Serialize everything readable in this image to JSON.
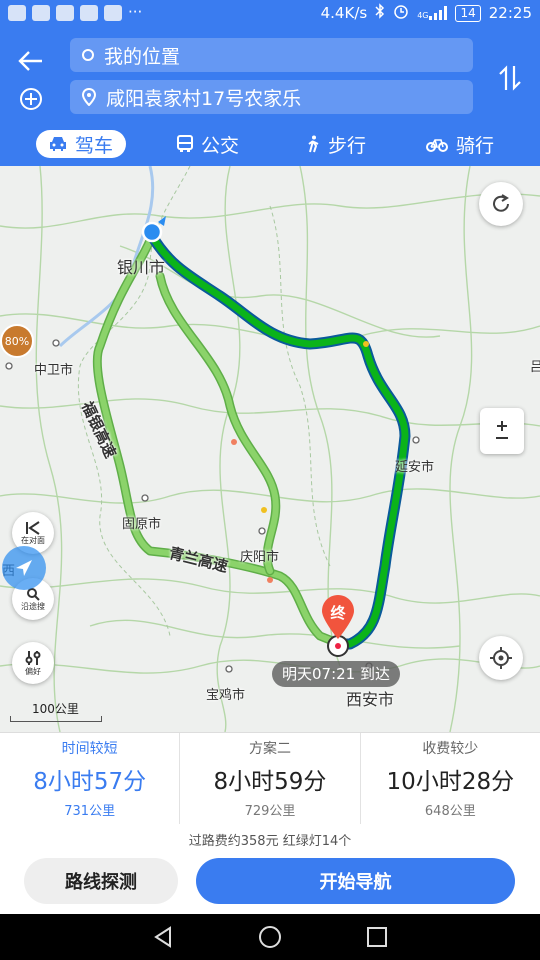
{
  "status_bar": {
    "net_speed": "4.4K/s",
    "signal_label": "4G",
    "battery": "14",
    "time": "22:25"
  },
  "header": {
    "start": "我的位置",
    "destination": "咸阳袁家村17号农家乐",
    "tabs": [
      {
        "label": "驾车",
        "icon": "car-icon",
        "active": true
      },
      {
        "label": "公交",
        "icon": "bus-icon",
        "active": false
      },
      {
        "label": "步行",
        "icon": "walk-icon",
        "active": false
      },
      {
        "label": "骑行",
        "icon": "bike-icon",
        "active": false
      }
    ]
  },
  "map": {
    "cities": [
      "银川市",
      "中卫市",
      "固原市",
      "庆阳市",
      "延安市",
      "宝鸡市",
      "西安市"
    ],
    "highways": [
      "福银高速",
      "青兰高速"
    ],
    "end_marker": "终",
    "eta": "明天07:21 到达",
    "scale": "100公里",
    "traffic_badge": "80%",
    "side_buttons": {
      "opposite": "在对面",
      "along": "沿途搜",
      "prefs": "偏好"
    },
    "edge_labels": {
      "left": "西",
      "right": "吕"
    },
    "route_colors": {
      "active": "#0bb31a",
      "active_outline": "#0a5a9a",
      "alternative": "#8bd36a"
    }
  },
  "routes": [
    {
      "label": "时间较短",
      "time": "8小时57分",
      "distance": "731公里",
      "active": true
    },
    {
      "label": "方案二",
      "time": "8小时59分",
      "distance": "729公里",
      "active": false
    },
    {
      "label": "收费较少",
      "time": "10小时28分",
      "distance": "648公里",
      "active": false
    }
  ],
  "fees_info": "过路费约358元  红绿灯14个",
  "buttons": {
    "explore": "路线探测",
    "navigate": "开始导航"
  }
}
